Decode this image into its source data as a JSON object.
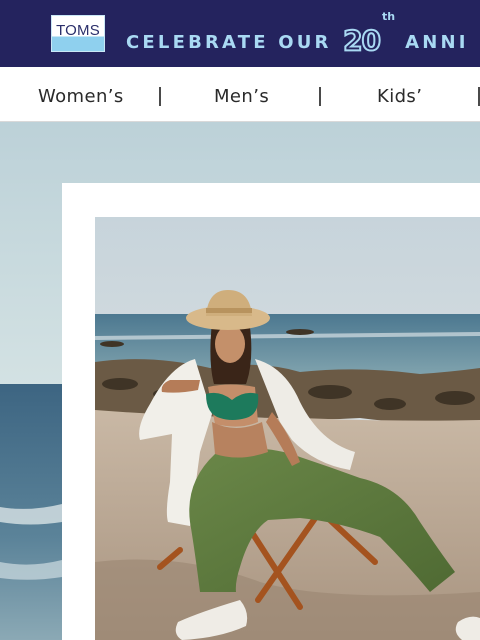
{
  "promo": {
    "brand": "TOMS",
    "text_before": "CELEBRATE OUR",
    "number": "20",
    "ordinal": "th",
    "text_after": "ANNI"
  },
  "nav": {
    "items": [
      {
        "label": "Women’s"
      },
      {
        "label": "Men’s"
      },
      {
        "label": "Kids’"
      }
    ]
  },
  "colors": {
    "banner_bg": "#24235e",
    "banner_text": "#a9d9f3",
    "pants": "#5e7a3e",
    "swimsuit": "#1d7a5c"
  },
  "hero": {
    "icon": "beach-photo"
  }
}
